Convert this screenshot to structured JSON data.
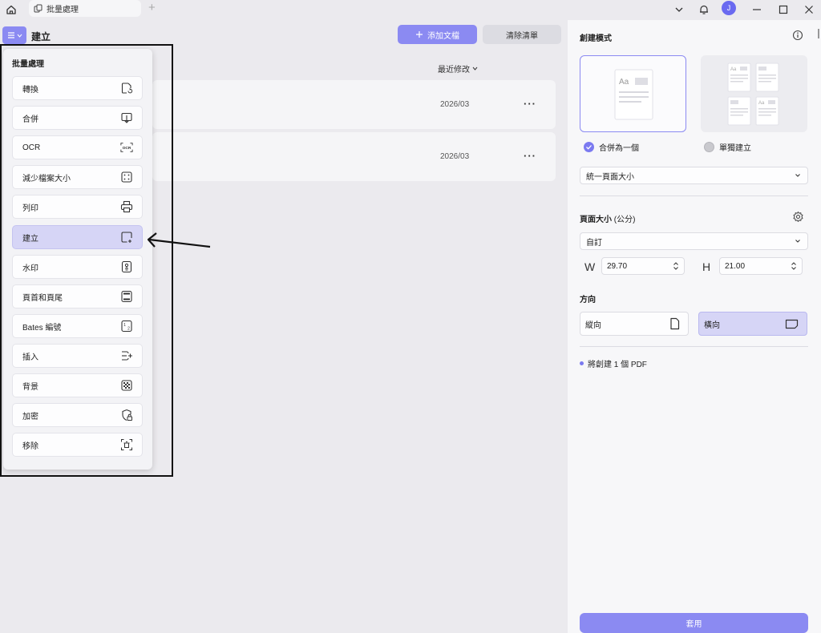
{
  "titlebar": {
    "tab_label": "批量處理",
    "tab_add": "+",
    "avatar_initial": "J"
  },
  "toolbar": {
    "title": "建立",
    "add_file_label": "添加文檔",
    "clear_list_label": "清除清單",
    "sort_label": "最近修改"
  },
  "files": [
    {
      "date": "2026/03",
      "more": "···"
    },
    {
      "date": "2026/03",
      "more": "···"
    }
  ],
  "menu": {
    "title": "批量處理",
    "items": [
      {
        "label": "轉換",
        "icon": "convert-icon"
      },
      {
        "label": "合併",
        "icon": "combine-icon"
      },
      {
        "label": "OCR",
        "icon": "ocr-icon"
      },
      {
        "label": "減少檔案大小",
        "icon": "compress-icon"
      },
      {
        "label": "列印",
        "icon": "printer-icon"
      },
      {
        "label": "建立",
        "icon": "create-icon",
        "active": true
      },
      {
        "label": "水印",
        "icon": "watermark-icon"
      },
      {
        "label": "頁首和頁尾",
        "icon": "header-footer-icon"
      },
      {
        "label": "Bates 編號",
        "icon": "bates-number-icon"
      },
      {
        "label": "插入",
        "icon": "insert-icon"
      },
      {
        "label": "背景",
        "icon": "background-icon"
      },
      {
        "label": "加密",
        "icon": "encrypt-icon"
      },
      {
        "label": "移除",
        "icon": "remove-icon"
      }
    ]
  },
  "panel": {
    "title": "創建模式",
    "mode_merge_label": "合併為一個",
    "mode_single_label": "單獨建立",
    "page_size_mode": "統一頁面大小",
    "page_size_label": "頁面大小",
    "page_size_unit": "(公分)",
    "page_size_preset": "自訂",
    "width_letter": "W",
    "width_value": "29.70",
    "height_letter": "H",
    "height_value": "21.00",
    "orientation_label": "方向",
    "portrait_label": "縱向",
    "landscape_label": "橫向",
    "note": "將創建 1 個 PDF",
    "apply_label": "套用",
    "preview_text": "Aa"
  },
  "colors": {
    "accent": "#8b8af2",
    "accent_light": "#d6d5f6",
    "background": "#ebeaee",
    "panel": "#f7f7f9"
  }
}
